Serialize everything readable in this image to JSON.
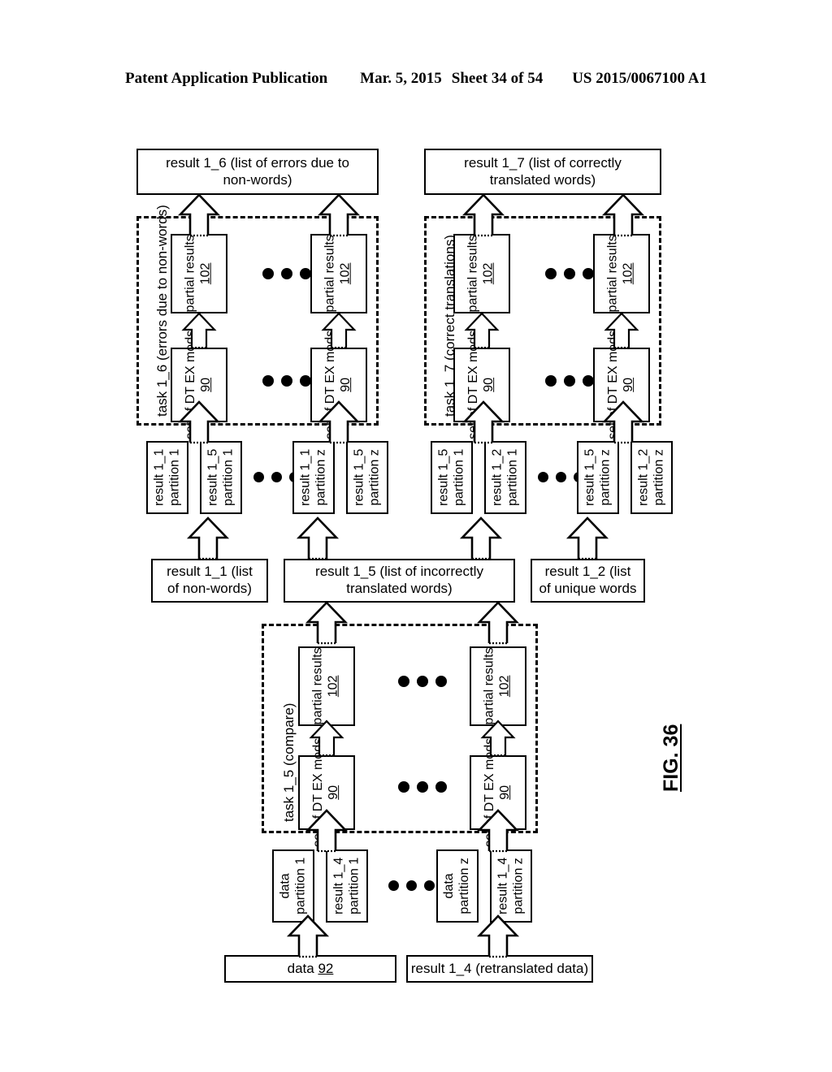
{
  "header": {
    "publication": "Patent Application Publication",
    "date": "Mar. 5, 2015",
    "sheet": "Sheet 34 of 54",
    "patent_number": "US 2015/0067100 A1"
  },
  "figure_label": "FIG. 36",
  "top_results": [
    {
      "id": "result-1-6",
      "text": "result 1_6 (list of errors due to non-words)"
    },
    {
      "id": "result-1-7",
      "text": "result 1_7 (list of correctly translated words)"
    }
  ],
  "task_boxes": {
    "task_1_6": {
      "label": "task 1_6 (errors due to non-words)",
      "partial_results_label": "partial results",
      "partial_results_ref": "102",
      "dt_ex_label": "set of DT EX mods",
      "dt_ex_ref": "90"
    },
    "task_1_7": {
      "label": "task 1_7 (correct translations)",
      "partial_results_label": "partial results",
      "partial_results_ref": "102",
      "dt_ex_label": "set of DT EX mods",
      "dt_ex_ref": "90"
    },
    "task_1_5": {
      "label": "task 1_5 (compare)",
      "partial_results_label": "partial results",
      "partial_results_ref": "102",
      "dt_ex_label": "set of DT EX mods",
      "dt_ex_ref": "90"
    }
  },
  "partition_row_upper": [
    {
      "line1": "result 1_1",
      "line2": "partition 1"
    },
    {
      "line1": "result 1_5",
      "line2": "partition 1"
    },
    {
      "line1": "result 1_1",
      "line2": "partition z"
    },
    {
      "line1": "result 1_5",
      "line2": "partition z"
    },
    {
      "line1": "result 1_5",
      "line2": "partition 1"
    },
    {
      "line1": "result 1_2",
      "line2": "partition 1"
    },
    {
      "line1": "result 1_5",
      "line2": "partition z"
    },
    {
      "line1": "result 1_2",
      "line2": "partition z"
    }
  ],
  "mid_results": [
    {
      "id": "result-1-1",
      "text": "result 1_1 (list of non-words)"
    },
    {
      "id": "result-1-5",
      "text": "result 1_5 (list of incorrectly translated words)"
    },
    {
      "id": "result-1-2",
      "text": "result 1_2 (list of unique words"
    }
  ],
  "partition_row_lower": [
    {
      "line1": "data",
      "line2": "partition 1"
    },
    {
      "line1": "result 1_4",
      "line2": "partition 1"
    },
    {
      "line1": "data",
      "line2": "partition z"
    },
    {
      "line1": "result 1_4",
      "line2": "partition z"
    }
  ],
  "bottom_sources": [
    {
      "id": "data-92",
      "text": "data ",
      "ref": "92"
    },
    {
      "id": "result-1-4",
      "text": "result 1_4 (retranslated data)",
      "ref": ""
    }
  ]
}
